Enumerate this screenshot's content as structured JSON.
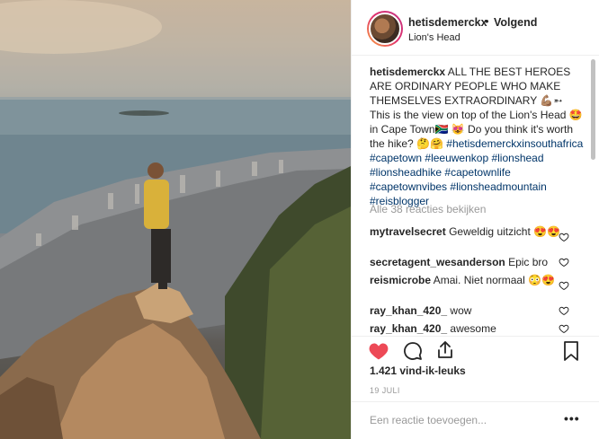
{
  "post": {
    "username": "hetisdemerckx",
    "dot": "•",
    "follow_label": "Volgend",
    "location": "Lion's Head"
  },
  "caption": {
    "username": "hetisdemerckx",
    "text_1": "ALL THE BEST HEROES ARE ORDINARY PEOPLE WHO MAKE THEMSELVES EXTRAORDINARY 💪🏽➵ This is the view on top of the Lion's Head 🤩 in Cape Town🇿🇦 😻 Do you think it's worth the hike? 🤔🤗",
    "hashtags": [
      "#hetisdemerckxinsouthafrica",
      "#capetown",
      "#leeuwenkop",
      "#lionshead",
      "#lionsheadhike",
      "#capetownlife",
      "#capetownvibes",
      "#lionsheadmountain",
      "#reisblogger"
    ]
  },
  "view_all_label": "Alle 38 reacties bekijken",
  "comments": [
    {
      "user": "mytravelsecret",
      "text": "Geweldig uitzicht 😍😍"
    },
    {
      "user": "secretagent_wesanderson",
      "text": "Epic bro"
    },
    {
      "user": "reismicrobe",
      "text": "Amai. Niet normaal 😳😍"
    },
    {
      "user": "ray_khan_420_",
      "text": "wow"
    },
    {
      "user": "ray_khan_420_",
      "text": "awesome"
    }
  ],
  "likes_label": "1.421 vind-ik-leuks",
  "date_label": "19 JULI",
  "add_comment_placeholder": "Een reactie toevoegen...",
  "more_label": "•••",
  "icons": {
    "like": "heart-filled-icon",
    "comment": "speech-bubble-icon",
    "share": "share-upload-icon",
    "save": "bookmark-icon",
    "comment_like": "heart-outline-icon"
  },
  "colors": {
    "like_red": "#ed4956",
    "hashtag": "#003569",
    "muted": "#999999",
    "text": "#262626"
  }
}
